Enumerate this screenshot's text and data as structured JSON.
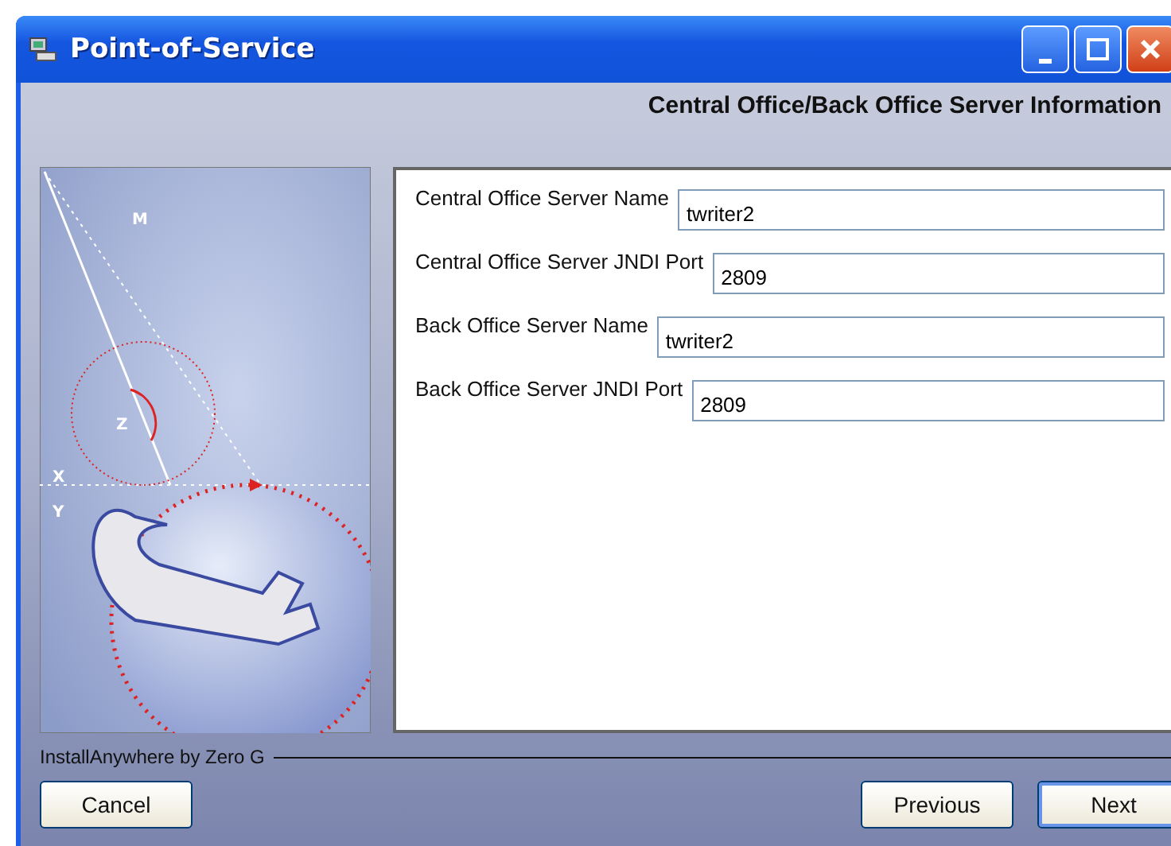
{
  "window": {
    "title": "Point-of-Service"
  },
  "art_labels": [
    "M",
    "Z",
    "X",
    "Y"
  ],
  "heading": "Central Office/Back Office Server Information",
  "fields": [
    {
      "label": "Central Office Server Name",
      "value": "twriter2"
    },
    {
      "label": "Central Office Server JNDI Port",
      "value": "2809"
    },
    {
      "label": "Back Office Server Name",
      "value": "twriter2"
    },
    {
      "label": "Back Office Server JNDI Port",
      "value": "2809"
    }
  ],
  "footer": {
    "label": "InstallAnywhere by Zero G"
  },
  "buttons": {
    "left": [
      {
        "label": "Cancel",
        "default": false
      }
    ],
    "right": [
      {
        "label": "Previous",
        "default": false
      },
      {
        "label": "Next",
        "default": true
      }
    ]
  }
}
